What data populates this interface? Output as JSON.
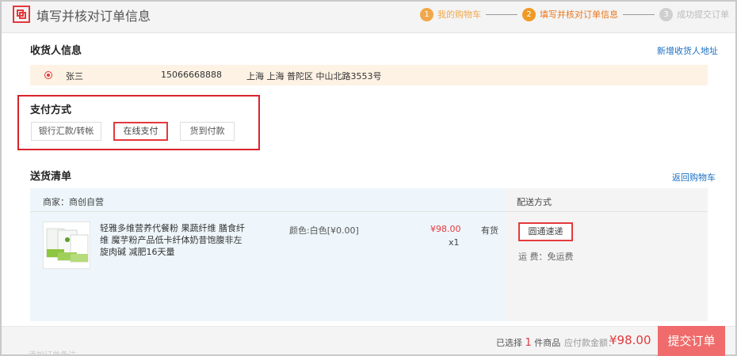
{
  "header": {
    "title": "填写并核对订单信息",
    "steps": [
      {
        "num": "1",
        "label": "我的购物车"
      },
      {
        "num": "2",
        "label": "填写并核对订单信息"
      },
      {
        "num": "3",
        "label": "成功提交订单"
      }
    ]
  },
  "consignee": {
    "title": "收货人信息",
    "add_link": "新增收货人地址",
    "name": "张三",
    "phone": "15066668888",
    "address": "上海 上海 普陀区  中山北路3553号"
  },
  "payment": {
    "title": "支付方式",
    "options": [
      "银行汇款/转帐",
      "在线支付",
      "货到付款"
    ],
    "selected": "在线支付"
  },
  "delivery_list": {
    "title": "送货清单",
    "back_link": "返回购物车",
    "merchant": "商家：商创自营",
    "delivery_header": "配送方式",
    "product": {
      "name": "轻雅多维营养代餐粉 果蔬纤维 膳食纤维 魔芋粉产品低卡纤体奶昔饱腹非左旋肉碱 减肥16天量",
      "attr": "颜色:白色[¥0.00]",
      "price": "¥98.00",
      "qty": "x1",
      "stock": "有货"
    },
    "shipping_method": "圆通速递",
    "shipping_fee": "运      费：免运费"
  },
  "footer": {
    "selected_prefix": "已选择",
    "selected_num": "1",
    "selected_suffix": "件商品",
    "total_label": "应付款金额：",
    "total_value": "¥98.00",
    "submit": "提交订单",
    "faded_text": "添加订单备注"
  },
  "colors": {
    "accent": "#e4393c",
    "step_done": "#f1a84a",
    "address_bg": "#fdf2e4",
    "submit_bg": "#f06b6b"
  }
}
